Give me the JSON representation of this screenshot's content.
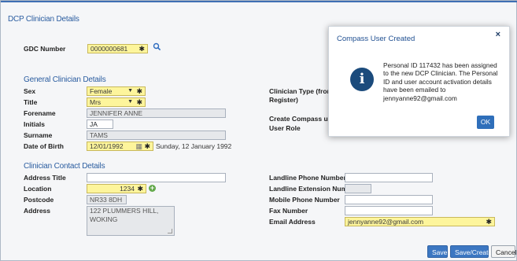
{
  "page": {
    "title": "DCP Clinician Details"
  },
  "gdc": {
    "label": "GDC Number",
    "value": "0000000681",
    "star": "✱"
  },
  "general": {
    "title": "General Clinician Details",
    "sex": {
      "label": "Sex",
      "value": "Female"
    },
    "title_field": {
      "label": "Title",
      "value": "Mrs"
    },
    "forename": {
      "label": "Forename",
      "value": "JENNIFER ANNE"
    },
    "initials": {
      "label": "Initials",
      "value": "JA"
    },
    "surname": {
      "label": "Surname",
      "value": "TAMS"
    },
    "dob": {
      "label": "Date of Birth",
      "value": "12/01/1992",
      "long": "Sunday, 12 January 1992"
    },
    "clinician_type": {
      "label_line1": "Clinician Type (from G",
      "label_line2": "Register)"
    },
    "create_compass": {
      "label": "Create Compass user"
    },
    "user_role": {
      "label": "User Role"
    }
  },
  "contact": {
    "title": "Clinician Contact Details",
    "address_title": {
      "label": "Address Title",
      "value": ""
    },
    "location": {
      "label": "Location",
      "value": "1234"
    },
    "postcode": {
      "label": "Postcode",
      "value": "NR33 8DH"
    },
    "address": {
      "label": "Address",
      "value": "122 PLUMMERS HILL, WOKING"
    },
    "landline": {
      "label": "Landline Phone Number",
      "value": ""
    },
    "landline_ext": {
      "label": "Landline Extension Number",
      "value": ""
    },
    "mobile": {
      "label": "Mobile Phone Number",
      "value": ""
    },
    "fax": {
      "label": "Fax Number",
      "value": ""
    },
    "email": {
      "label": "Email Address",
      "value": "jennyanne92@gmail.com"
    }
  },
  "buttons": {
    "save": "Save",
    "save_create": "Save/Create",
    "cancel": "Cancel"
  },
  "dialog": {
    "title": "Compass User Created",
    "close": "×",
    "message": "Personal ID 117432 has been assigned to the new DCP Clinician. The Personal ID and user account activation details have been emailed to jennyanne92@gmail.com",
    "ok": "OK",
    "icon": "info-icon"
  },
  "icons": {
    "search": "search-icon",
    "add": "plus-icon",
    "calendar": "calendar-icon",
    "dropdown": "chevron-down-icon"
  },
  "colors": {
    "accent": "#2b5da0",
    "required": "#fdf59c",
    "button": "#3c77c2",
    "dialog_icon": "#1b4b7c"
  }
}
